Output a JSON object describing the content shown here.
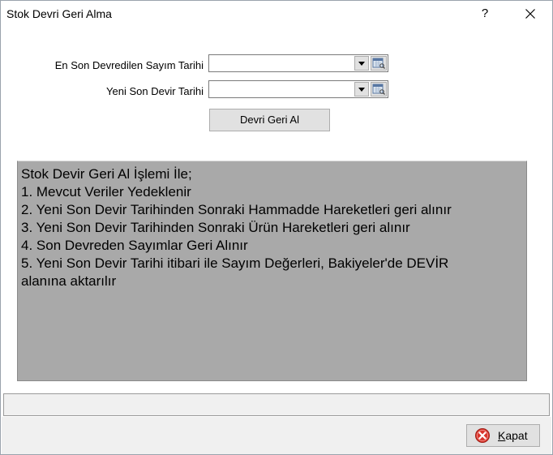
{
  "window": {
    "title": "Stok Devri Geri Alma",
    "help_label": "?"
  },
  "form": {
    "last_transfer_label": "En Son Devredilen Sayım Tarihi",
    "last_transfer_value": "",
    "new_transfer_label": "Yeni Son Devir Tarihi",
    "new_transfer_value": "",
    "action_button": "Devri Geri Al"
  },
  "info": {
    "lines": [
      "Stok Devir Geri Al İşlemi İle;",
      "1. Mevcut Veriler Yedeklenir",
      "2. Yeni Son Devir Tarihinden Sonraki Hammadde Hareketleri geri alınır",
      "3. Yeni Son Devir Tarihinden Sonraki Ürün Hareketleri geri alınır",
      "4. Son Devreden Sayımlar Geri Alınır",
      "5. Yeni Son Devir Tarihi itibari ile Sayım Değerleri, Bakiyeler'de DEVİR",
      "alanına aktarılır"
    ]
  },
  "footer": {
    "status_text": "",
    "close_button": "Kapat"
  },
  "colors": {
    "info_panel_bg": "#a9a9a9",
    "close_icon_red": "#d9342b"
  }
}
